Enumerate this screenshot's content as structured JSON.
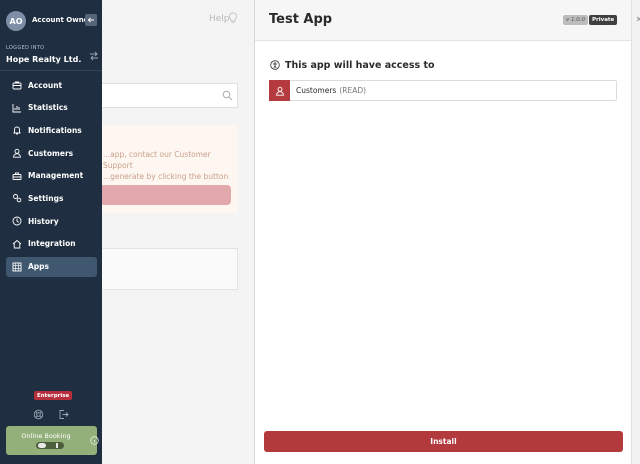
{
  "background": {
    "help_label": "Help",
    "notice_line1": "...app, contact our Customer Support",
    "notice_line2": "...generate by clicking the button"
  },
  "sidebar": {
    "avatar_initials": "AO",
    "owner_name": "Account Owner",
    "logged_into_label": "LOGGED INTO",
    "org_name": "Hope Realty Ltd.",
    "items": [
      {
        "label": "Account",
        "icon": "briefcase-icon"
      },
      {
        "label": "Statistics",
        "icon": "bar-chart-icon"
      },
      {
        "label": "Notifications",
        "icon": "bell-icon"
      },
      {
        "label": "Customers",
        "icon": "user-icon"
      },
      {
        "label": "Management",
        "icon": "toolbox-icon"
      },
      {
        "label": "Settings",
        "icon": "gears-icon"
      },
      {
        "label": "History",
        "icon": "clock-icon"
      },
      {
        "label": "Integration",
        "icon": "house-icon"
      },
      {
        "label": "Apps",
        "icon": "grid-icon",
        "active": true
      }
    ],
    "plan_badge": "Enterprise",
    "booking": {
      "label": "Online Booking",
      "toggle_state": "off"
    }
  },
  "panel": {
    "title": "Test App",
    "version": "v 1.0.0",
    "visibility": "Private",
    "access_heading": "This app will have access to",
    "permissions": [
      {
        "name": "Customers",
        "scope": "(READ)"
      }
    ],
    "install_label": "Install"
  },
  "colors": {
    "sidebar_bg": "#1f2e40",
    "active_nav": "#40586f",
    "accent_red": "#b33a3c",
    "enterprise_badge": "#b72e3c",
    "booking_green": "#94b07a"
  }
}
